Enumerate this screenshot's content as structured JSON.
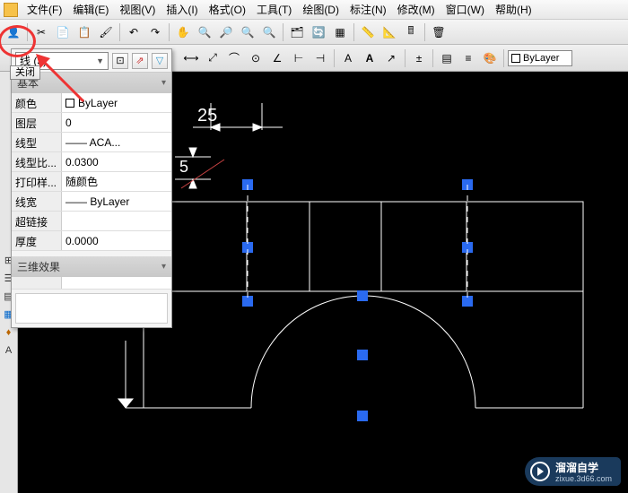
{
  "menu": {
    "items": [
      "文件(F)",
      "编辑(E)",
      "视图(V)",
      "插入(I)",
      "格式(O)",
      "工具(T)",
      "绘图(D)",
      "标注(N)",
      "修改(M)",
      "窗口(W)",
      "帮助(H)"
    ]
  },
  "toolbar2": {
    "layer_prefix": "□",
    "bylayer": "ByLayer"
  },
  "panel": {
    "close": "关闭",
    "selection": "线 (3)",
    "sections": {
      "basic": "基本",
      "effect3d": "三维效果"
    },
    "props": {
      "color_k": "颜色",
      "color_v": "ByLayer",
      "layer_k": "图层",
      "layer_v": "0",
      "ltype_k": "线型",
      "ltype_v": "—— ACA...",
      "ltscale_k": "线型比...",
      "ltscale_v": "0.0300",
      "plot_k": "打印样...",
      "plot_v": "随颜色",
      "lw_k": "线宽",
      "lw_v": "—— ByLayer",
      "link_k": "超链接",
      "link_v": "",
      "thick_k": "厚度",
      "thick_v": "0.0000"
    }
  },
  "drawing": {
    "dim1": "25",
    "dim2": "5"
  },
  "watermark": {
    "brand": "溜溜自学",
    "url": "zixue.3d66.com"
  }
}
